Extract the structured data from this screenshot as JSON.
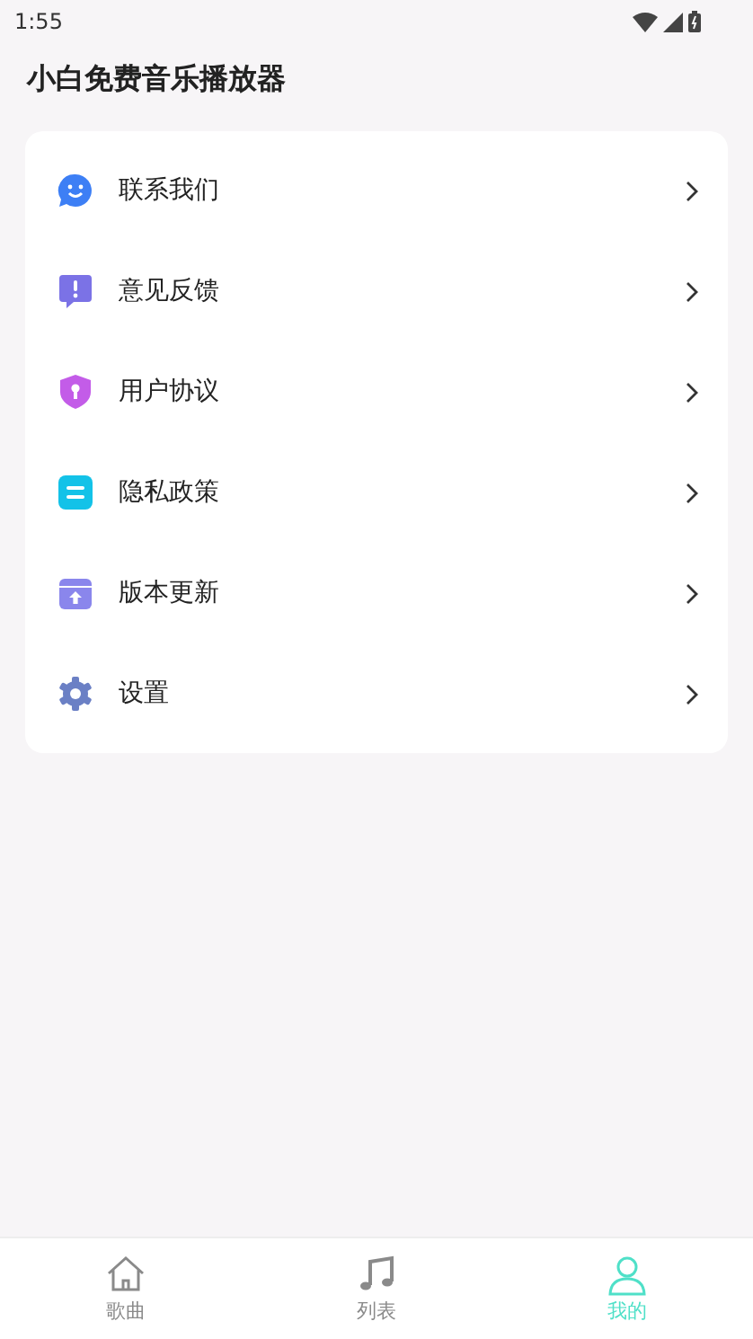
{
  "status_bar": {
    "time": "1:55"
  },
  "app_bar": {
    "title": "小白免费音乐播放器"
  },
  "menu": [
    {
      "label": "联系我们"
    },
    {
      "label": "意见反馈"
    },
    {
      "label": "用户协议"
    },
    {
      "label": "隐私政策"
    },
    {
      "label": "版本更新"
    },
    {
      "label": "设置"
    }
  ],
  "bottom_nav": [
    {
      "label": "歌曲",
      "selected": false
    },
    {
      "label": "列表",
      "selected": false
    },
    {
      "label": "我的",
      "selected": true
    }
  ]
}
